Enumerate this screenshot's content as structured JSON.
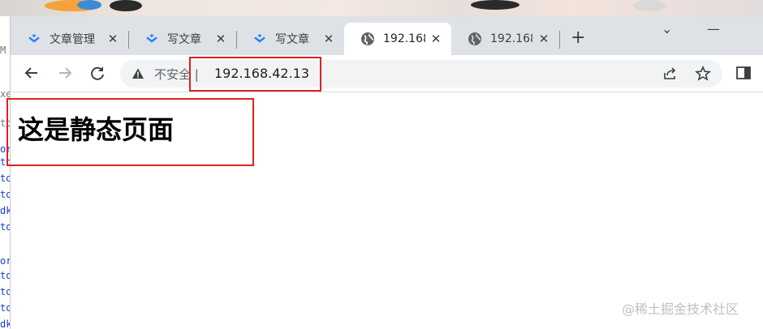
{
  "tabs": [
    {
      "title": "文章管理",
      "favicon": "juejin-logo-icon",
      "active": false
    },
    {
      "title": "写文章",
      "favicon": "juejin-logo-icon",
      "active": false
    },
    {
      "title": "写文章",
      "favicon": "juejin-logo-icon",
      "active": false
    },
    {
      "title": "192.168",
      "favicon": "globe-icon",
      "active": true
    },
    {
      "title": "192.168",
      "favicon": "globe-icon",
      "active": false
    }
  ],
  "tab_close_glyph": "✕",
  "new_tab_glyph": "+",
  "window_controls": {
    "tab_search": "⌄",
    "minimize": "—"
  },
  "address_bar": {
    "security_label": "不安全 |",
    "url": "192.168.42.13"
  },
  "page": {
    "heading": "这是静态页面"
  },
  "watermark": "@稀土掘金技术社区",
  "colors": {
    "tabstrip": "#dee1e6",
    "omnibox": "#f1f3f4",
    "annotation_red": "#e02020",
    "juejin_blue": "#1e80ff"
  }
}
